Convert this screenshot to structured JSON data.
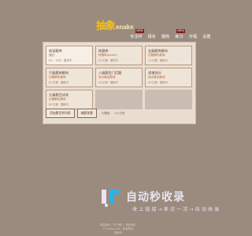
{
  "logo": {
    "cn": "抽象",
    "en": "enake"
  },
  "topnav": {
    "items": [
      {
        "label": "专注时",
        "badge": "NEW"
      },
      {
        "label": "报名",
        "badge": ""
      },
      {
        "label": "题库",
        "badge": ""
      },
      {
        "label": "练习",
        "badge": "NEW"
      },
      {
        "label": "日程",
        "badge": ""
      },
      {
        "label": "设置",
        "badge": ""
      }
    ]
  },
  "cards": [
    {
      "title": "阅读题库",
      "sub": "通过",
      "meta": "6人 · 15分 · 数学中"
    },
    {
      "title": "练题库",
      "sub": "练题库(exam)",
      "meta": "0人已练 · 数学中"
    },
    {
      "title": "五级题库解析",
      "sub": "试题解析题库",
      "meta": "1人已练 · 题库中"
    },
    {
      "title": "六级题库解析",
      "sub": "试题解析题库",
      "meta": "0人已练 · 题库中"
    },
    {
      "title": "八级题目门后题",
      "sub": "适合最后解读",
      "meta": "0人已练 · 题库中"
    },
    {
      "title": "语笔划分",
      "sub": "适合最后解读",
      "meta": "0人已练 · 题库中"
    },
    {
      "title": "九级题目试炼",
      "sub": "试题解析题库",
      "meta": "0人已练 · 题库中"
    }
  ],
  "bottom": {
    "btn1": "添加题目到列表",
    "btn2": "随题答题",
    "text1": "5/题数",
    "text2": "0人已练"
  },
  "watermark": {
    "main": "自动秒收录",
    "sub": "收 上 链 接 → 来 访 一 次 → 自 动 收 录"
  },
  "footer": {
    "line1": "网站首页 · 关于我们 · 联系我们",
    "line2": "© enake.com · 版权所有",
    "line3": "备案号"
  }
}
